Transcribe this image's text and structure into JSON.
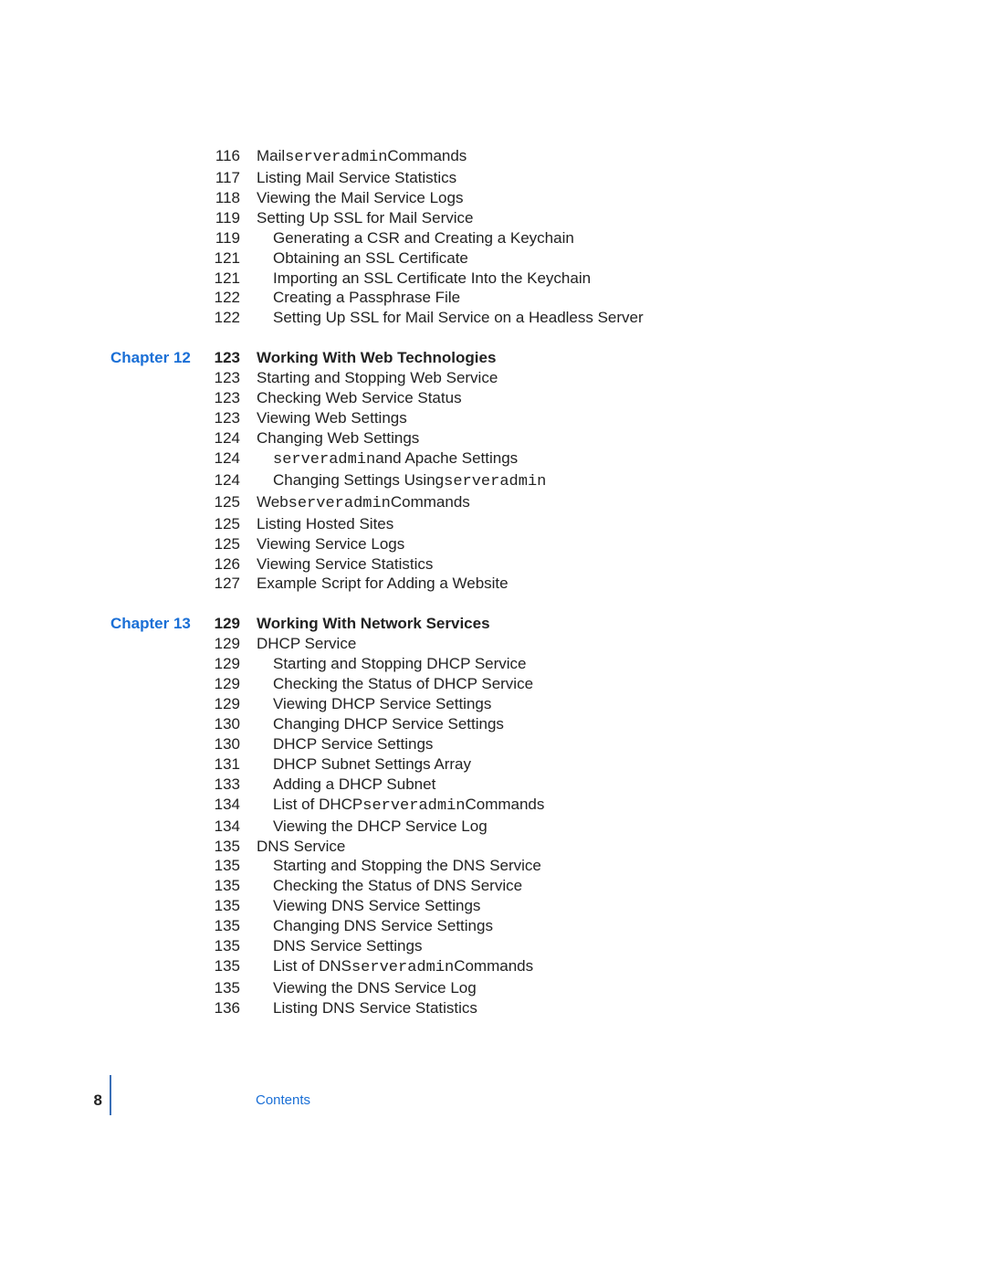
{
  "entries": [
    {
      "page": "116",
      "chapter": "",
      "bold": false,
      "indent": 0,
      "parts": [
        {
          "t": "Mail ",
          "mono": false
        },
        {
          "t": "serveradmin",
          "mono": true
        },
        {
          "t": " Commands",
          "mono": false
        }
      ]
    },
    {
      "page": "117",
      "chapter": "",
      "bold": false,
      "indent": 0,
      "parts": [
        {
          "t": "Listing Mail Service Statistics",
          "mono": false
        }
      ]
    },
    {
      "page": "118",
      "chapter": "",
      "bold": false,
      "indent": 0,
      "parts": [
        {
          "t": "Viewing the Mail Service Logs",
          "mono": false
        }
      ]
    },
    {
      "page": "119",
      "chapter": "",
      "bold": false,
      "indent": 0,
      "parts": [
        {
          "t": "Setting Up SSL for Mail Service",
          "mono": false
        }
      ]
    },
    {
      "page": "119",
      "chapter": "",
      "bold": false,
      "indent": 1,
      "parts": [
        {
          "t": "Generating a CSR and Creating a Keychain",
          "mono": false
        }
      ]
    },
    {
      "page": "121",
      "chapter": "",
      "bold": false,
      "indent": 1,
      "parts": [
        {
          "t": "Obtaining an SSL Certificate",
          "mono": false
        }
      ]
    },
    {
      "page": "121",
      "chapter": "",
      "bold": false,
      "indent": 1,
      "parts": [
        {
          "t": "Importing an SSL Certificate Into the Keychain",
          "mono": false
        }
      ]
    },
    {
      "page": "122",
      "chapter": "",
      "bold": false,
      "indent": 1,
      "parts": [
        {
          "t": "Creating a Passphrase File",
          "mono": false
        }
      ]
    },
    {
      "page": "122",
      "chapter": "",
      "bold": false,
      "indent": 1,
      "parts": [
        {
          "t": "Setting Up SSL for Mail Service on a Headless Server",
          "mono": false
        }
      ]
    },
    {
      "break": true
    },
    {
      "page": "123",
      "chapter": "Chapter 12",
      "bold": true,
      "indent": 0,
      "parts": [
        {
          "t": "Working With Web Technologies",
          "mono": false
        }
      ]
    },
    {
      "page": "123",
      "chapter": "",
      "bold": false,
      "indent": 0,
      "parts": [
        {
          "t": "Starting and Stopping Web Service",
          "mono": false
        }
      ]
    },
    {
      "page": "123",
      "chapter": "",
      "bold": false,
      "indent": 0,
      "parts": [
        {
          "t": "Checking Web Service Status",
          "mono": false
        }
      ]
    },
    {
      "page": "123",
      "chapter": "",
      "bold": false,
      "indent": 0,
      "parts": [
        {
          "t": "Viewing Web Settings",
          "mono": false
        }
      ]
    },
    {
      "page": "124",
      "chapter": "",
      "bold": false,
      "indent": 0,
      "parts": [
        {
          "t": "Changing Web Settings",
          "mono": false
        }
      ]
    },
    {
      "page": "124",
      "chapter": "",
      "bold": false,
      "indent": 1,
      "parts": [
        {
          "t": "serveradmin",
          "mono": true
        },
        {
          "t": " and Apache Settings",
          "mono": false
        }
      ]
    },
    {
      "page": "124",
      "chapter": "",
      "bold": false,
      "indent": 1,
      "parts": [
        {
          "t": "Changing Settings Using ",
          "mono": false
        },
        {
          "t": "serveradmin",
          "mono": true
        }
      ]
    },
    {
      "page": "125",
      "chapter": "",
      "bold": false,
      "indent": 0,
      "parts": [
        {
          "t": "Web ",
          "mono": false
        },
        {
          "t": "serveradmin",
          "mono": true
        },
        {
          "t": " Commands",
          "mono": false
        }
      ]
    },
    {
      "page": "125",
      "chapter": "",
      "bold": false,
      "indent": 0,
      "parts": [
        {
          "t": "Listing Hosted Sites",
          "mono": false
        }
      ]
    },
    {
      "page": "125",
      "chapter": "",
      "bold": false,
      "indent": 0,
      "parts": [
        {
          "t": "Viewing Service Logs",
          "mono": false
        }
      ]
    },
    {
      "page": "126",
      "chapter": "",
      "bold": false,
      "indent": 0,
      "parts": [
        {
          "t": "Viewing Service Statistics",
          "mono": false
        }
      ]
    },
    {
      "page": "127",
      "chapter": "",
      "bold": false,
      "indent": 0,
      "parts": [
        {
          "t": "Example Script for Adding a Website",
          "mono": false
        }
      ]
    },
    {
      "break": true
    },
    {
      "page": "129",
      "chapter": "Chapter 13",
      "bold": true,
      "indent": 0,
      "parts": [
        {
          "t": "Working With Network Services",
          "mono": false
        }
      ]
    },
    {
      "page": "129",
      "chapter": "",
      "bold": false,
      "indent": 0,
      "parts": [
        {
          "t": "DHCP Service",
          "mono": false
        }
      ]
    },
    {
      "page": "129",
      "chapter": "",
      "bold": false,
      "indent": 1,
      "parts": [
        {
          "t": "Starting and Stopping DHCP Service",
          "mono": false
        }
      ]
    },
    {
      "page": "129",
      "chapter": "",
      "bold": false,
      "indent": 1,
      "parts": [
        {
          "t": "Checking the Status of DHCP Service",
          "mono": false
        }
      ]
    },
    {
      "page": "129",
      "chapter": "",
      "bold": false,
      "indent": 1,
      "parts": [
        {
          "t": "Viewing DHCP Service Settings",
          "mono": false
        }
      ]
    },
    {
      "page": "130",
      "chapter": "",
      "bold": false,
      "indent": 1,
      "parts": [
        {
          "t": "Changing DHCP Service Settings",
          "mono": false
        }
      ]
    },
    {
      "page": "130",
      "chapter": "",
      "bold": false,
      "indent": 1,
      "parts": [
        {
          "t": "DHCP Service Settings",
          "mono": false
        }
      ]
    },
    {
      "page": "131",
      "chapter": "",
      "bold": false,
      "indent": 1,
      "parts": [
        {
          "t": "DHCP Subnet Settings Array",
          "mono": false
        }
      ]
    },
    {
      "page": "133",
      "chapter": "",
      "bold": false,
      "indent": 1,
      "parts": [
        {
          "t": "Adding a DHCP Subnet",
          "mono": false
        }
      ]
    },
    {
      "page": "134",
      "chapter": "",
      "bold": false,
      "indent": 1,
      "parts": [
        {
          "t": "List of DHCP ",
          "mono": false
        },
        {
          "t": "serveradmin",
          "mono": true
        },
        {
          "t": " Commands",
          "mono": false
        }
      ]
    },
    {
      "page": "134",
      "chapter": "",
      "bold": false,
      "indent": 1,
      "parts": [
        {
          "t": "Viewing the DHCP Service Log",
          "mono": false
        }
      ]
    },
    {
      "page": "135",
      "chapter": "",
      "bold": false,
      "indent": 0,
      "parts": [
        {
          "t": "DNS Service",
          "mono": false
        }
      ]
    },
    {
      "page": "135",
      "chapter": "",
      "bold": false,
      "indent": 1,
      "parts": [
        {
          "t": "Starting and Stopping the DNS Service",
          "mono": false
        }
      ]
    },
    {
      "page": "135",
      "chapter": "",
      "bold": false,
      "indent": 1,
      "parts": [
        {
          "t": "Checking the Status of DNS Service",
          "mono": false
        }
      ]
    },
    {
      "page": "135",
      "chapter": "",
      "bold": false,
      "indent": 1,
      "parts": [
        {
          "t": "Viewing DNS Service Settings",
          "mono": false
        }
      ]
    },
    {
      "page": "135",
      "chapter": "",
      "bold": false,
      "indent": 1,
      "parts": [
        {
          "t": "Changing DNS Service Settings",
          "mono": false
        }
      ]
    },
    {
      "page": "135",
      "chapter": "",
      "bold": false,
      "indent": 1,
      "parts": [
        {
          "t": "DNS Service Settings",
          "mono": false
        }
      ]
    },
    {
      "page": "135",
      "chapter": "",
      "bold": false,
      "indent": 1,
      "parts": [
        {
          "t": "List of DNS ",
          "mono": false
        },
        {
          "t": "serveradmin",
          "mono": true
        },
        {
          "t": " Commands",
          "mono": false
        }
      ]
    },
    {
      "page": "135",
      "chapter": "",
      "bold": false,
      "indent": 1,
      "parts": [
        {
          "t": "Viewing the DNS Service Log",
          "mono": false
        }
      ]
    },
    {
      "page": "136",
      "chapter": "",
      "bold": false,
      "indent": 1,
      "parts": [
        {
          "t": "Listing DNS Service Statistics",
          "mono": false
        }
      ]
    }
  ],
  "footer": {
    "page_number": "8",
    "label": "Contents"
  }
}
